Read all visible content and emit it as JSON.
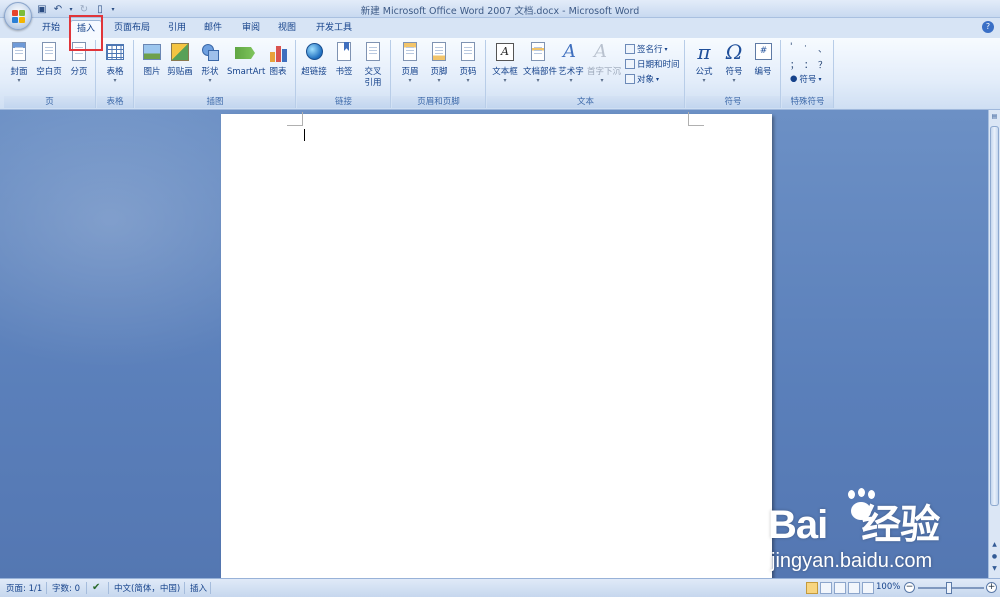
{
  "window": {
    "title": "新建 Microsoft Office Word 2007 文档.docx - Microsoft Word"
  },
  "qat": {
    "save_icon": "save-icon",
    "undo_icon": "undo-icon",
    "redo_icon": "redo-icon",
    "new_icon": "new-doc-icon",
    "customize_icon": "customize-icon"
  },
  "tabs": [
    {
      "label": "开始"
    },
    {
      "label": "插入"
    },
    {
      "label": "页面布局"
    },
    {
      "label": "引用"
    },
    {
      "label": "邮件"
    },
    {
      "label": "审阅"
    },
    {
      "label": "视图"
    },
    {
      "label": "开发工具"
    }
  ],
  "help": {
    "symbol": "?"
  },
  "ribbon": {
    "groups": [
      {
        "label": "页",
        "buttons": [
          {
            "label": "封面"
          },
          {
            "label": "空白页"
          },
          {
            "label": "分页"
          }
        ]
      },
      {
        "label": "表格",
        "buttons": [
          {
            "label": "表格"
          }
        ]
      },
      {
        "label": "插图",
        "buttons": [
          {
            "label": "图片"
          },
          {
            "label": "剪贴画"
          },
          {
            "label": "形状"
          },
          {
            "label": "SmartArt"
          },
          {
            "label": "图表"
          }
        ]
      },
      {
        "label": "链接",
        "buttons": [
          {
            "label": "超链接"
          },
          {
            "label": "书签"
          },
          {
            "label": "交叉",
            "label2": "引用"
          }
        ]
      },
      {
        "label": "页眉和页脚",
        "buttons": [
          {
            "label": "页眉"
          },
          {
            "label": "页脚"
          },
          {
            "label": "页码"
          }
        ]
      },
      {
        "label": "文本",
        "buttons": [
          {
            "label": "文本框"
          },
          {
            "label": "文档部件"
          },
          {
            "label": "艺术字"
          },
          {
            "label": "首字下沉"
          }
        ],
        "small": [
          {
            "label": "签名行"
          },
          {
            "label": "日期和时间"
          },
          {
            "label": "对象"
          }
        ]
      },
      {
        "label": "符号",
        "buttons": [
          {
            "label": "公式",
            "glyph": "π"
          },
          {
            "label": "符号",
            "glyph": "Ω"
          },
          {
            "label": "编号",
            "glyph": "#"
          }
        ]
      },
      {
        "label": "特殊符号",
        "marks": [
          "'",
          "·",
          "、",
          "；",
          "：",
          "？"
        ],
        "dropdown": "符号"
      }
    ]
  },
  "status": {
    "page": "页面: 1/1",
    "words": "字数: 0",
    "language": "中文(简体，中国)",
    "mode": "插入",
    "zoom": "100%"
  },
  "watermark": {
    "brand": "Bai",
    "brand2": "经验",
    "url": "jingyan.baidu.com"
  }
}
